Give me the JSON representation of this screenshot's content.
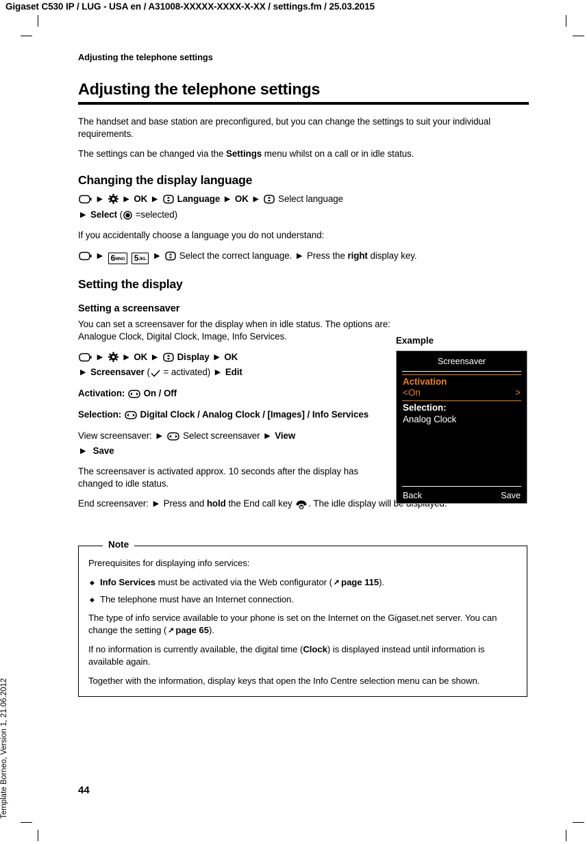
{
  "document_header": "Gigaset C530 IP / LUG - USA en / A31008-XXXXX-XXXX-X-XX / settings.fm / 25.03.2015",
  "template_footer": "Template Borneo, Version 1, 21.06.2012",
  "page_number": "44",
  "running_title": "Adjusting the telephone settings",
  "chapter_title": "Adjusting the telephone settings",
  "intro": {
    "paragraph_1": "The handset and base station are preconfigured, but you can change the settings to suit your individual requirements.",
    "paragraph_2_pre": "The settings can be changed via the ",
    "paragraph_2_bold": "Settings",
    "paragraph_2_post": " menu whilst on a call or in idle status."
  },
  "language_section": {
    "heading": "Changing the display language",
    "nav_1": {
      "ok_1": "OK",
      "language": "Language",
      "ok_2": "OK",
      "select_language": "Select language",
      "select": "Select",
      "selected_note": "=selected)",
      "open_paren": "("
    },
    "fallback_intro": "If you accidentally choose a language you do not understand:",
    "nav_2": {
      "key_6_digit": "6",
      "key_6_letters": "MNO",
      "key_5_digit": "5",
      "key_5_letters": "JKL",
      "select_correct": "Select the correct language.",
      "press_pre": "Press the ",
      "press_bold": "right",
      "press_post": " display key."
    }
  },
  "display_section": {
    "heading": "Setting the display",
    "screensaver": {
      "heading": "Setting a screensaver",
      "intro": "You can set a screensaver for the display when in idle status. The options are: Analogue Clock, Digital Clock, Image, Info Services.",
      "nav": {
        "ok_1": "OK",
        "display": "Display",
        "ok_2": "OK",
        "screensaver": "Screensaver",
        "activated_note": "= activated)",
        "open_paren": "(",
        "edit": "Edit"
      },
      "activation_label": "Activation:",
      "activation_values": "On / Off",
      "selection_label": "Selection:",
      "selection_values": "Digital Clock / Analog Clock / [Images] / Info Services",
      "view_label": "View screensaver:",
      "view_select": "Select screensaver",
      "view_button": "View",
      "save_button": "Save",
      "activation_note": "The screensaver is activated approx. 10 seconds after the display has changed to idle status.",
      "end_label": "End screensaver:",
      "end_pre": "Press and ",
      "end_bold": "hold",
      "end_mid": " the End call key",
      "end_post": ". The idle display will be displayed."
    }
  },
  "example": {
    "label": "Example",
    "title": "Screensaver",
    "item_activation": "Activation",
    "value_on_left": "<On",
    "value_on_right": ">",
    "item_selection": "Selection:",
    "value_selection": "Analog Clock",
    "softkey_left": "Back",
    "softkey_right": "Save",
    "accent_color": "#e8821e",
    "background_color": "#000000",
    "text_color": "#ffffff"
  },
  "note": {
    "legend": "Note",
    "intro": "Prerequisites for displaying info services:",
    "bullets": [
      {
        "bold": "Info Services",
        "text_pre": " must be activated via the Web configurator (",
        "ref": "page 115",
        "text_post": ")."
      },
      {
        "bold": "",
        "text_pre": "The telephone must have an Internet connection.",
        "ref": "",
        "text_post": ""
      }
    ],
    "paragraph_1_pre": "The type of info service available to your phone is set on the Internet on the Gigaset.net server. You can change the setting (",
    "paragraph_1_ref": "page 65",
    "paragraph_1_post": ").",
    "paragraph_2_pre": "If no information is currently available, the digital time (",
    "paragraph_2_bold": "Clock",
    "paragraph_2_post": ") is displayed instead until information is available again.",
    "paragraph_3": "Together with the information, display keys that open the Info Centre selection menu can be shown."
  }
}
